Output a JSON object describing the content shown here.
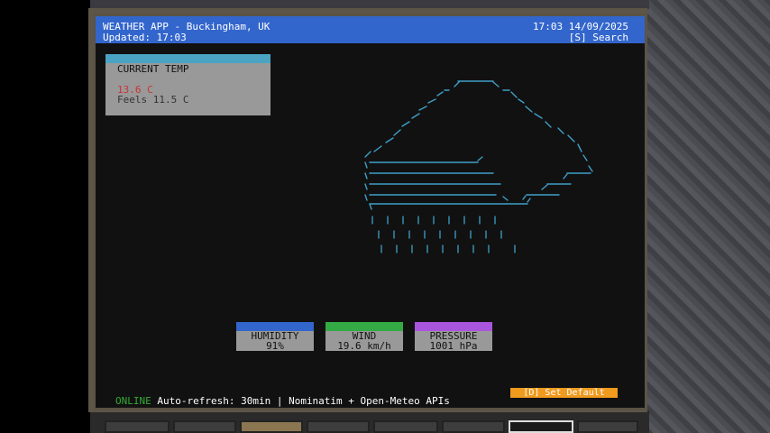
{
  "header": {
    "title": "WEATHER APP - Buckingham, UK",
    "updated": "Updated: 17:03",
    "datetime": "17:03 14/09/2025",
    "search": "[S] Search"
  },
  "temperature": {
    "label": "CURRENT TEMP",
    "value": "13.6 C",
    "feels": "Feels 11.5 C"
  },
  "weather_icon": "rain-cloud-ascii",
  "metrics": [
    {
      "label": "HUMIDITY",
      "value": "91%",
      "color": "#3366cc"
    },
    {
      "label": "WIND",
      "value": "19.6 km/h",
      "color": "#33aa44"
    },
    {
      "label": "PRESSURE",
      "value": "1001 hPa",
      "color": "#aa55dd"
    }
  ],
  "footer": {
    "online": "ONLINE",
    "info": "Auto-refresh: 30min | Nominatim + Open-Meteo APIs",
    "set_default": "[D] Set Default"
  },
  "colors": {
    "titlebar": "#3366cc",
    "temp_header": "#4aa3c2",
    "temp_value": "#cc3333",
    "ascii_art": "#3fa0c8",
    "online": "#33aa33",
    "set_default": "#f09a1e"
  }
}
